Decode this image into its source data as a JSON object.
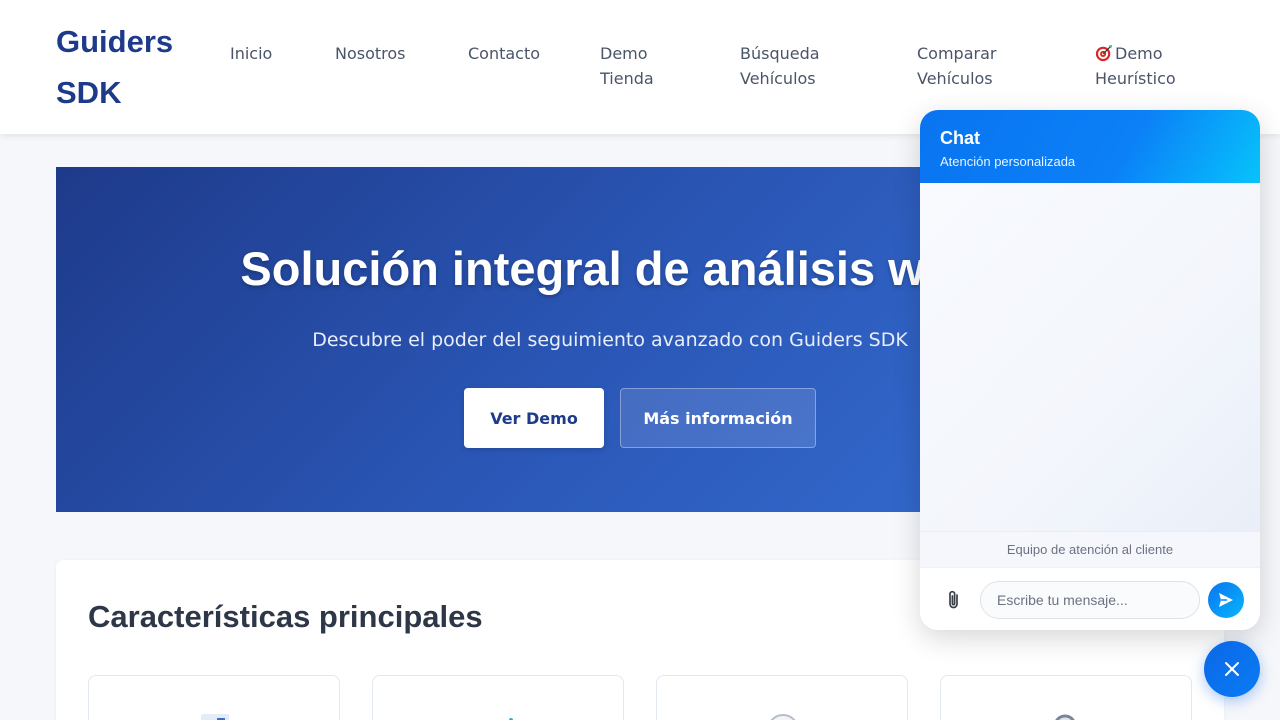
{
  "header": {
    "logo": "Guiders SDK",
    "nav": [
      {
        "label": "Inicio"
      },
      {
        "label": "Nosotros"
      },
      {
        "label": "Contacto"
      },
      {
        "label": "Demo Tienda"
      },
      {
        "label": "Búsqueda Vehículos"
      },
      {
        "label": "Comparar Vehículos"
      },
      {
        "label": "Demo Heurístico",
        "icon": "target-icon"
      }
    ]
  },
  "hero": {
    "title": "Solución integral de análisis web",
    "subtitle": "Descubre el poder del seguimiento avanzado con Guiders SDK",
    "primary_button": "Ver Demo",
    "secondary_button": "Más información"
  },
  "features": {
    "title": "Características principales",
    "cards": [
      {
        "icon": "bar-chart-icon"
      },
      {
        "icon": "chart-trend-icon"
      },
      {
        "icon": "clock-icon"
      },
      {
        "icon": "search-icon"
      }
    ]
  },
  "chat": {
    "title": "Chat",
    "subtitle": "Atención personalizada",
    "team_label": "Equipo de atención al cliente",
    "input_placeholder": "Escribe tu mensaje...",
    "attach_icon": "paperclip-icon",
    "send_icon": "send-icon",
    "close_icon": "close-icon"
  },
  "colors": {
    "brand": "#1e3a8a",
    "hero_gradient_start": "#1e3a8a",
    "hero_gradient_end": "#3671d6",
    "chat_accent": "#0a74f0"
  }
}
